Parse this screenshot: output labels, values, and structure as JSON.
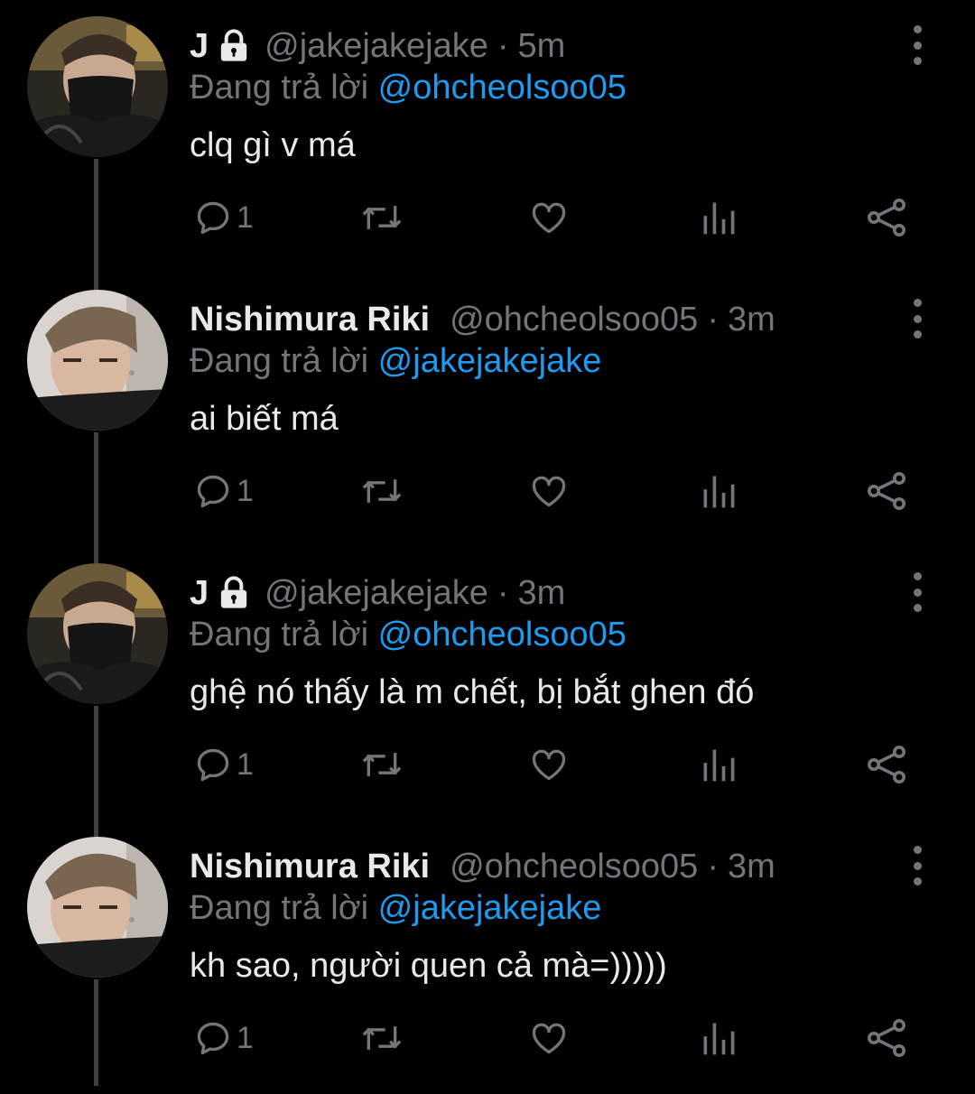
{
  "tweets": [
    {
      "name": "J",
      "locked": true,
      "handle": "@jakejakejake",
      "separator": "·",
      "time": "5m",
      "replying_prefix": "Đang trả lời",
      "replying_to": "@ohcheolsoo05",
      "text": "clq gì v má",
      "reply_count": "1",
      "avatar": "jake"
    },
    {
      "name": "Nishimura Riki",
      "locked": false,
      "handle": "@ohcheolsoo05",
      "separator": "·",
      "time": "3m",
      "replying_prefix": "Đang trả lời",
      "replying_to": "@jakejakejake",
      "text": "ai biết má",
      "reply_count": "1",
      "avatar": "riki"
    },
    {
      "name": "J",
      "locked": true,
      "handle": "@jakejakejake",
      "separator": "·",
      "time": "3m",
      "replying_prefix": "Đang trả lời",
      "replying_to": "@ohcheolsoo05",
      "text": "ghệ nó thấy là m chết, bị bắt ghen đó",
      "reply_count": "1",
      "avatar": "jake"
    },
    {
      "name": "Nishimura Riki",
      "locked": false,
      "handle": "@ohcheolsoo05",
      "separator": "·",
      "time": "3m",
      "replying_prefix": "Đang trả lời",
      "replying_to": "@jakejakejake",
      "text": "kh sao, người quen cả mà=)))))",
      "reply_count": "1",
      "avatar": "riki"
    }
  ],
  "colors": {
    "background": "#000000",
    "text": "#e7e9ea",
    "secondary": "#71767b",
    "mention": "#1d9bf0",
    "thread_line": "#3d4146"
  },
  "icons": {
    "reply": "reply-icon",
    "retweet": "retweet-icon",
    "like": "heart-icon",
    "analytics": "analytics-icon",
    "share": "share-icon",
    "more": "more-vertical-icon",
    "lock": "lock-icon"
  }
}
